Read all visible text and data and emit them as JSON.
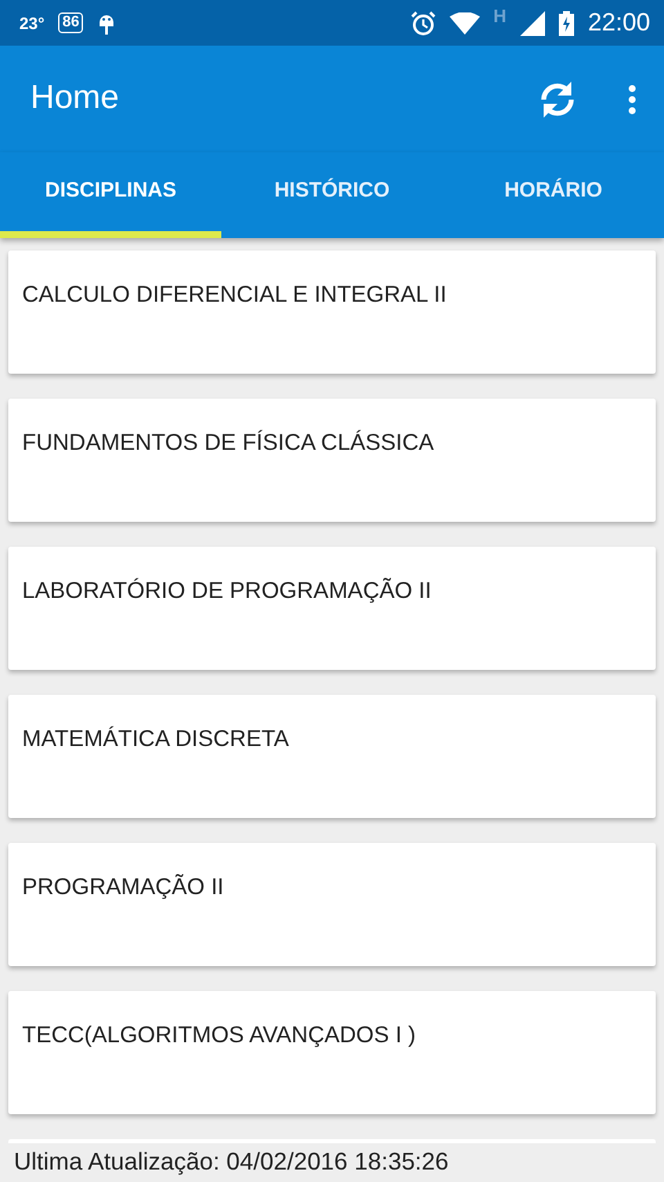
{
  "status_bar": {
    "temperature": "23°",
    "notification_badge": "86",
    "network_type": "H",
    "time": "22:00"
  },
  "app_bar": {
    "title": "Home"
  },
  "tabs": [
    {
      "label": "DISCIPLINAS",
      "selected": true
    },
    {
      "label": "HISTÓRICO",
      "selected": false
    },
    {
      "label": "HORÁRIO",
      "selected": false
    }
  ],
  "subjects": [
    {
      "name": "CALCULO DIFERENCIAL E INTEGRAL II"
    },
    {
      "name": "FUNDAMENTOS DE FÍSICA CLÁSSICA"
    },
    {
      "name": "LABORATÓRIO DE PROGRAMAÇÃO II"
    },
    {
      "name": "MATEMÁTICA DISCRETA"
    },
    {
      "name": "PROGRAMAÇÃO II"
    },
    {
      "name": "TECC(ALGORITMOS AVANÇADOS I )"
    }
  ],
  "footer": {
    "last_update": "Ultima Atualização: 04/02/2016 18:35:26"
  }
}
